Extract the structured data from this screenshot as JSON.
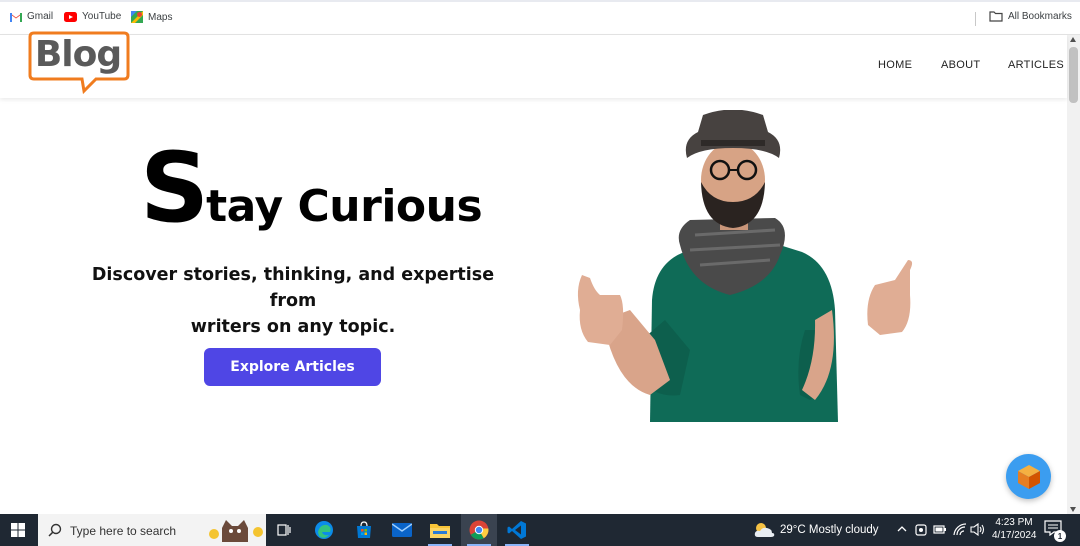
{
  "bookmarks": {
    "items": [
      {
        "label": "Gmail",
        "icon": "gmail-icon"
      },
      {
        "label": "YouTube",
        "icon": "youtube-icon"
      },
      {
        "label": "Maps",
        "icon": "maps-icon"
      }
    ],
    "all_bookmarks": "All Bookmarks"
  },
  "site": {
    "logo_text": "Blog",
    "nav": [
      "HOME",
      "ABOUT",
      "ARTICLES"
    ]
  },
  "hero": {
    "title_cap": "S",
    "title_rest": "tay Curious",
    "subtitle_line1": "Discover stories, thinking, and expertise from",
    "subtitle_line2": "writers on any topic.",
    "cta_label": "Explore Articles"
  },
  "colors": {
    "accent": "#4f46e5",
    "logo_orange": "#f07c1f",
    "logo_gray": "#5a5a5a",
    "fab_blue": "#3b9df0",
    "taskbar": "#1f2833"
  },
  "taskbar": {
    "search_placeholder": "Type here to search",
    "weather": "29°C  Mostly cloudy",
    "time": "4:23 PM",
    "date": "4/17/2024",
    "notification_count": "1"
  }
}
